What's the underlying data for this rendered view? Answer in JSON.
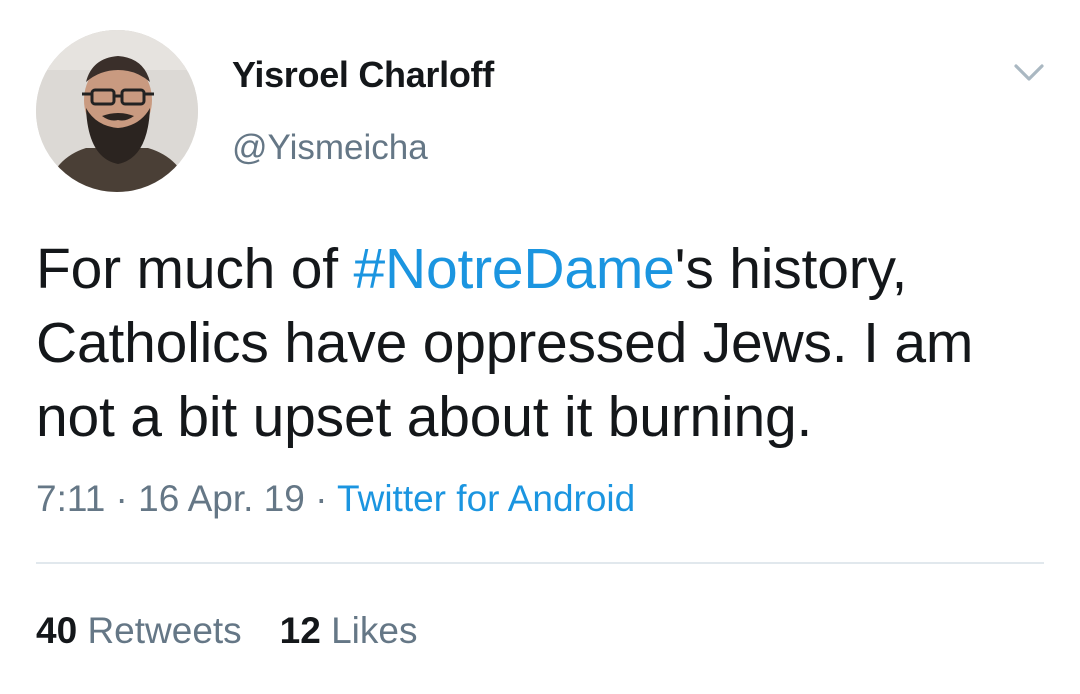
{
  "author": {
    "name": "Yisroel Charloff",
    "handle": "@Yismeicha",
    "avatar_icon": "user-avatar-photo"
  },
  "tweet": {
    "text_before": "For much of ",
    "hashtag": "#NotreDame",
    "text_after": "'s history, Catholics have oppressed Jews. I am not a bit upset about it burning."
  },
  "meta": {
    "time": "7:11",
    "separator": " · ",
    "date": "16 Apr. 19",
    "source": "Twitter for Android"
  },
  "stats": {
    "retweets_count": "40",
    "retweets_label": "Retweets",
    "likes_count": "12",
    "likes_label": "Likes"
  },
  "icons": {
    "menu": "chevron-down-icon"
  },
  "colors": {
    "text": "#14171a",
    "secondary": "#657786",
    "link": "#1b95e0",
    "divider": "#e1e8ed"
  }
}
